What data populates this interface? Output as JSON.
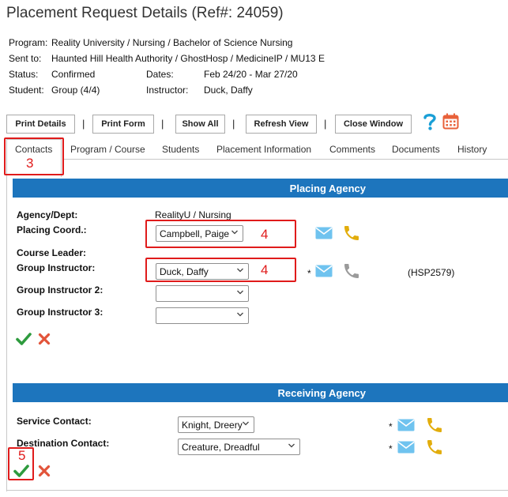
{
  "page": {
    "title": "Placement Request Details (Ref#: 24059)"
  },
  "info": {
    "program_label": "Program:",
    "program_value": "Reality University / Nursing / Bachelor of Science Nursing",
    "sent_label": "Sent to:",
    "sent_value": "Haunted Hill Health Authority / GhostHosp / MedicineIP / MU13 E",
    "status_label": "Status:",
    "status_value": "Confirmed",
    "dates_label": "Dates:",
    "dates_value": "Feb 24/20 - Mar 27/20",
    "student_label": "Student:",
    "student_value": "Group (4/4)",
    "instructor_label": "Instructor:",
    "instructor_value": "Duck, Daffy"
  },
  "toolbar": {
    "print_details": "Print Details",
    "print_form": "Print Form",
    "show_all": "Show All",
    "refresh_view": "Refresh View",
    "close_window": "Close Window",
    "separator": "|"
  },
  "tabs": {
    "contacts": "Contacts",
    "program_course": "Program / Course",
    "students": "Students",
    "placement_information": "Placement Information",
    "comments": "Comments",
    "documents": "Documents",
    "history": "History"
  },
  "placing": {
    "header": "Placing Agency",
    "agency_label": "Agency/Dept:",
    "agency_value": "RealityU / Nursing",
    "coord_label": "Placing Coord.:",
    "coord_value": "Campbell, Paige",
    "course_leader_label": "Course Leader:",
    "group_instructor_label": "Group Instructor:",
    "group_instructor_value": "Duck, Daffy",
    "group_instructor2_label": "Group Instructor 2:",
    "group_instructor2_value": "",
    "group_instructor3_label": "Group Instructor 3:",
    "group_instructor3_value": "",
    "hsp": "(HSP2579)",
    "required_mark": "*"
  },
  "receiving": {
    "header": "Receiving Agency",
    "service_label": "Service Contact:",
    "service_value": "Knight, Dreery",
    "destination_label": "Destination Contact:",
    "destination_value": "Creature, Dreadful",
    "required_mark": "*"
  },
  "annotations": {
    "a3": "3",
    "a4a": "4",
    "a4b": "4",
    "a5": "5"
  },
  "colors": {
    "header_bar": "#1d75bd",
    "annotation_red": "#e01b1b",
    "check_green": "#2e9b3e",
    "cancel_red": "#e2543a",
    "envelope_blue": "#6fc3ef",
    "phone_gold": "#e2ad0c",
    "phone_gray": "#9a9a9a",
    "help_teal": "#1a9fd6",
    "calendar_orange": "#e8613a"
  },
  "icons": [
    "help-icon",
    "calendar-icon",
    "envelope-icon",
    "phone-icon",
    "check-icon",
    "cancel-icon",
    "chevron-down-icon"
  ]
}
